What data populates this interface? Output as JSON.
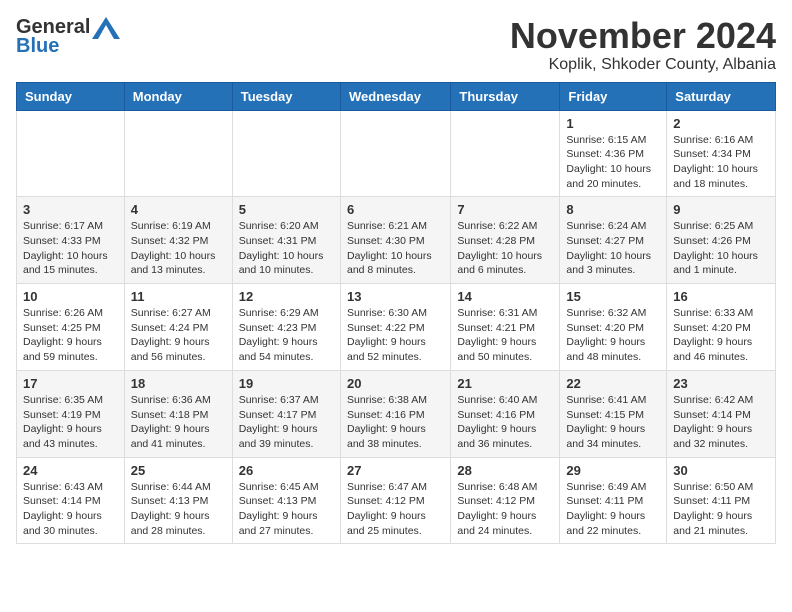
{
  "header": {
    "logo_general": "General",
    "logo_blue": "Blue",
    "month_title": "November 2024",
    "location": "Koplik, Shkoder County, Albania"
  },
  "days_of_week": [
    "Sunday",
    "Monday",
    "Tuesday",
    "Wednesday",
    "Thursday",
    "Friday",
    "Saturday"
  ],
  "weeks": [
    [
      {
        "day": "",
        "info": ""
      },
      {
        "day": "",
        "info": ""
      },
      {
        "day": "",
        "info": ""
      },
      {
        "day": "",
        "info": ""
      },
      {
        "day": "",
        "info": ""
      },
      {
        "day": "1",
        "info": "Sunrise: 6:15 AM\nSunset: 4:36 PM\nDaylight: 10 hours\nand 20 minutes."
      },
      {
        "day": "2",
        "info": "Sunrise: 6:16 AM\nSunset: 4:34 PM\nDaylight: 10 hours\nand 18 minutes."
      }
    ],
    [
      {
        "day": "3",
        "info": "Sunrise: 6:17 AM\nSunset: 4:33 PM\nDaylight: 10 hours\nand 15 minutes."
      },
      {
        "day": "4",
        "info": "Sunrise: 6:19 AM\nSunset: 4:32 PM\nDaylight: 10 hours\nand 13 minutes."
      },
      {
        "day": "5",
        "info": "Sunrise: 6:20 AM\nSunset: 4:31 PM\nDaylight: 10 hours\nand 10 minutes."
      },
      {
        "day": "6",
        "info": "Sunrise: 6:21 AM\nSunset: 4:30 PM\nDaylight: 10 hours\nand 8 minutes."
      },
      {
        "day": "7",
        "info": "Sunrise: 6:22 AM\nSunset: 4:28 PM\nDaylight: 10 hours\nand 6 minutes."
      },
      {
        "day": "8",
        "info": "Sunrise: 6:24 AM\nSunset: 4:27 PM\nDaylight: 10 hours\nand 3 minutes."
      },
      {
        "day": "9",
        "info": "Sunrise: 6:25 AM\nSunset: 4:26 PM\nDaylight: 10 hours\nand 1 minute."
      }
    ],
    [
      {
        "day": "10",
        "info": "Sunrise: 6:26 AM\nSunset: 4:25 PM\nDaylight: 9 hours\nand 59 minutes."
      },
      {
        "day": "11",
        "info": "Sunrise: 6:27 AM\nSunset: 4:24 PM\nDaylight: 9 hours\nand 56 minutes."
      },
      {
        "day": "12",
        "info": "Sunrise: 6:29 AM\nSunset: 4:23 PM\nDaylight: 9 hours\nand 54 minutes."
      },
      {
        "day": "13",
        "info": "Sunrise: 6:30 AM\nSunset: 4:22 PM\nDaylight: 9 hours\nand 52 minutes."
      },
      {
        "day": "14",
        "info": "Sunrise: 6:31 AM\nSunset: 4:21 PM\nDaylight: 9 hours\nand 50 minutes."
      },
      {
        "day": "15",
        "info": "Sunrise: 6:32 AM\nSunset: 4:20 PM\nDaylight: 9 hours\nand 48 minutes."
      },
      {
        "day": "16",
        "info": "Sunrise: 6:33 AM\nSunset: 4:20 PM\nDaylight: 9 hours\nand 46 minutes."
      }
    ],
    [
      {
        "day": "17",
        "info": "Sunrise: 6:35 AM\nSunset: 4:19 PM\nDaylight: 9 hours\nand 43 minutes."
      },
      {
        "day": "18",
        "info": "Sunrise: 6:36 AM\nSunset: 4:18 PM\nDaylight: 9 hours\nand 41 minutes."
      },
      {
        "day": "19",
        "info": "Sunrise: 6:37 AM\nSunset: 4:17 PM\nDaylight: 9 hours\nand 39 minutes."
      },
      {
        "day": "20",
        "info": "Sunrise: 6:38 AM\nSunset: 4:16 PM\nDaylight: 9 hours\nand 38 minutes."
      },
      {
        "day": "21",
        "info": "Sunrise: 6:40 AM\nSunset: 4:16 PM\nDaylight: 9 hours\nand 36 minutes."
      },
      {
        "day": "22",
        "info": "Sunrise: 6:41 AM\nSunset: 4:15 PM\nDaylight: 9 hours\nand 34 minutes."
      },
      {
        "day": "23",
        "info": "Sunrise: 6:42 AM\nSunset: 4:14 PM\nDaylight: 9 hours\nand 32 minutes."
      }
    ],
    [
      {
        "day": "24",
        "info": "Sunrise: 6:43 AM\nSunset: 4:14 PM\nDaylight: 9 hours\nand 30 minutes."
      },
      {
        "day": "25",
        "info": "Sunrise: 6:44 AM\nSunset: 4:13 PM\nDaylight: 9 hours\nand 28 minutes."
      },
      {
        "day": "26",
        "info": "Sunrise: 6:45 AM\nSunset: 4:13 PM\nDaylight: 9 hours\nand 27 minutes."
      },
      {
        "day": "27",
        "info": "Sunrise: 6:47 AM\nSunset: 4:12 PM\nDaylight: 9 hours\nand 25 minutes."
      },
      {
        "day": "28",
        "info": "Sunrise: 6:48 AM\nSunset: 4:12 PM\nDaylight: 9 hours\nand 24 minutes."
      },
      {
        "day": "29",
        "info": "Sunrise: 6:49 AM\nSunset: 4:11 PM\nDaylight: 9 hours\nand 22 minutes."
      },
      {
        "day": "30",
        "info": "Sunrise: 6:50 AM\nSunset: 4:11 PM\nDaylight: 9 hours\nand 21 minutes."
      }
    ]
  ]
}
